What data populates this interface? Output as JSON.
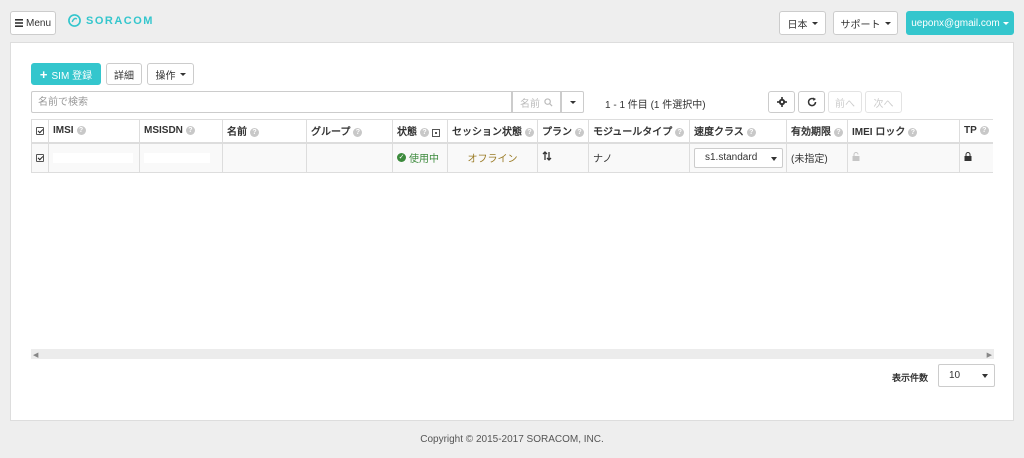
{
  "header": {
    "menu_label": "Menu",
    "logo_text": "SORACOM",
    "language_label": "日本",
    "support_label": "サポート",
    "user_email": "ueponx@gmail.com"
  },
  "toolbar": {
    "register_sim_label": "SIM 登録",
    "details_label": "詳細",
    "operations_label": "操作"
  },
  "search": {
    "placeholder": "名前で検索",
    "button_label": "名前",
    "result_count": "1 - 1 件目 (1 件選択中)"
  },
  "pagination": {
    "prev_label": "前へ",
    "next_label": "次へ",
    "per_page_label": "表示件数",
    "per_page_value": "10"
  },
  "table": {
    "columns": [
      "IMSI",
      "MSISDN",
      "名前",
      "グループ",
      "状態",
      "セッション状態",
      "プラン",
      "モジュールタイプ",
      "速度クラス",
      "有効期限",
      "IMEI ロック",
      "TP"
    ],
    "rows": [
      {
        "selected": true,
        "imsi": "",
        "msisdn": "",
        "name": "",
        "group": "",
        "status": "使用中",
        "session": "オフライン",
        "plan_icon": "sort-arrows-icon",
        "module_type": "ナノ",
        "speed_class": "s1.standard",
        "expiry": "(未指定)",
        "imei_lock": "unlocked",
        "tp": "locked"
      }
    ]
  },
  "footer": {
    "copyright": "Copyright © 2015-2017 SORACOM, INC."
  },
  "colors": {
    "accent": "#34c6cd",
    "status_active": "#3c8a3c",
    "session_offline": "#9a7b25"
  }
}
